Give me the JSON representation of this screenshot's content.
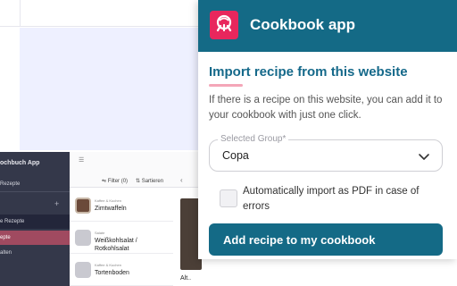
{
  "popup": {
    "app_title": "Cookbook app",
    "heading": "Import recipe from this website",
    "description": "If there is a recipe on this website, you can add it to your cookbook with just one click.",
    "group_select": {
      "label": "Selected Group*",
      "value": "Copa"
    },
    "pdf_checkbox": {
      "label": "Automatically import as PDF in case of errors",
      "checked": false
    },
    "add_button": "Add recipe to my cookbook",
    "colors": {
      "header": "#146a86",
      "accent": "#e8275d"
    }
  },
  "background_app": {
    "brand": "ochbuch App",
    "sidebar": [
      "Rezepte",
      "e Rezepte",
      "epte",
      "alten"
    ],
    "toolbar": {
      "filter": "Filter (0)",
      "sort": "Sartieren"
    },
    "recipes": [
      {
        "category": "Kaffee & Kuchen",
        "title": "Zimtwaffeln"
      },
      {
        "category": "Salate",
        "title": "Weißkohlsalat / Rotkohlsalat"
      },
      {
        "category": "Kaffee & Kuchen",
        "title": "Tortenboden"
      }
    ],
    "detail_caption": "Alt.."
  }
}
